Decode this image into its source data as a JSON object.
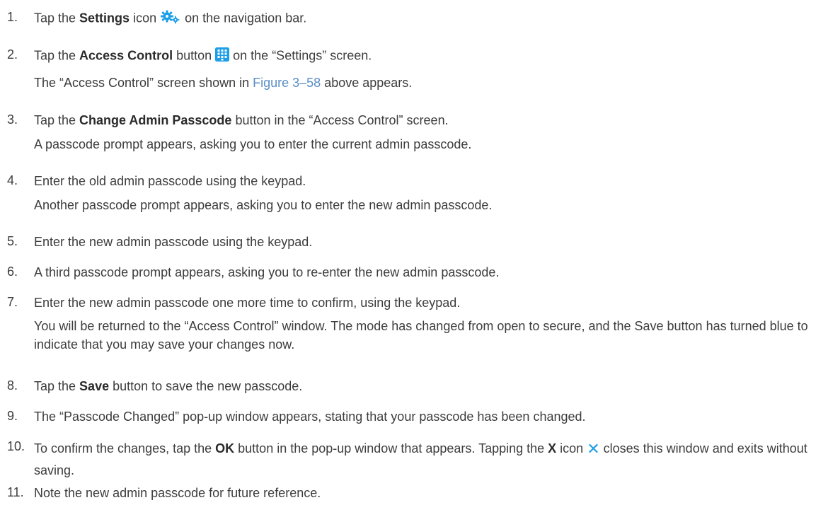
{
  "steps": [
    {
      "num": "1.",
      "pre": "Tap the ",
      "bold": "Settings",
      "post1": " icon ",
      "post2": " on the navigation bar.",
      "icon": "gear-icon"
    },
    {
      "num": "2.",
      "pre": "Tap the ",
      "bold": "Access Control",
      "post1": " button ",
      "post2": " on the “Settings” screen.",
      "icon": "keypad-icon",
      "note_pre": "The “Access Control” screen shown in ",
      "note_link": "Figure 3–58",
      "note_post": " above appears."
    },
    {
      "num": "3.",
      "pre": "Tap the ",
      "bold": "Change Admin Passcode",
      "post": " button in the “Access Control” screen.",
      "note": "A passcode prompt appears, asking you to enter the current admin passcode."
    },
    {
      "num": "4.",
      "text": "Enter the old admin passcode using the keypad.",
      "note": "Another passcode prompt appears, asking you to enter the new admin passcode."
    },
    {
      "num": "5.",
      "text": "Enter the new admin passcode using the keypad."
    },
    {
      "num": "6.",
      "text": "A third passcode prompt appears, asking you to re-enter the new admin passcode."
    },
    {
      "num": "7.",
      "text": "Enter the new admin passcode one more time to confirm, using the keypad.",
      "note": "You will be returned to the “Access Control” window. The mode has changed from open to secure, and the Save button has turned blue to indicate that you may save your changes now."
    },
    {
      "num": "8.",
      "pre": "Tap the ",
      "bold": "Save",
      "post": " button to save the new passcode."
    },
    {
      "num": "9.",
      "text": "The “Passcode Changed” pop-up window appears, stating that your passcode has been changed."
    },
    {
      "num": "10.",
      "pre": "To confirm the changes, tap the ",
      "bold": "OK",
      "mid": " button in the pop-up window that appears. Tapping the ",
      "bold2": "X",
      "mid2": " icon ",
      "post": " closes this window and exits without saving.",
      "icon": "close-icon",
      "icon_glyph": "✕"
    },
    {
      "num": "11.",
      "text": "Note the new admin passcode for future reference."
    }
  ],
  "colors": {
    "text": "#3c3c3c",
    "link": "#5a8ec6",
    "icon_blue": "#1c9ee8"
  }
}
